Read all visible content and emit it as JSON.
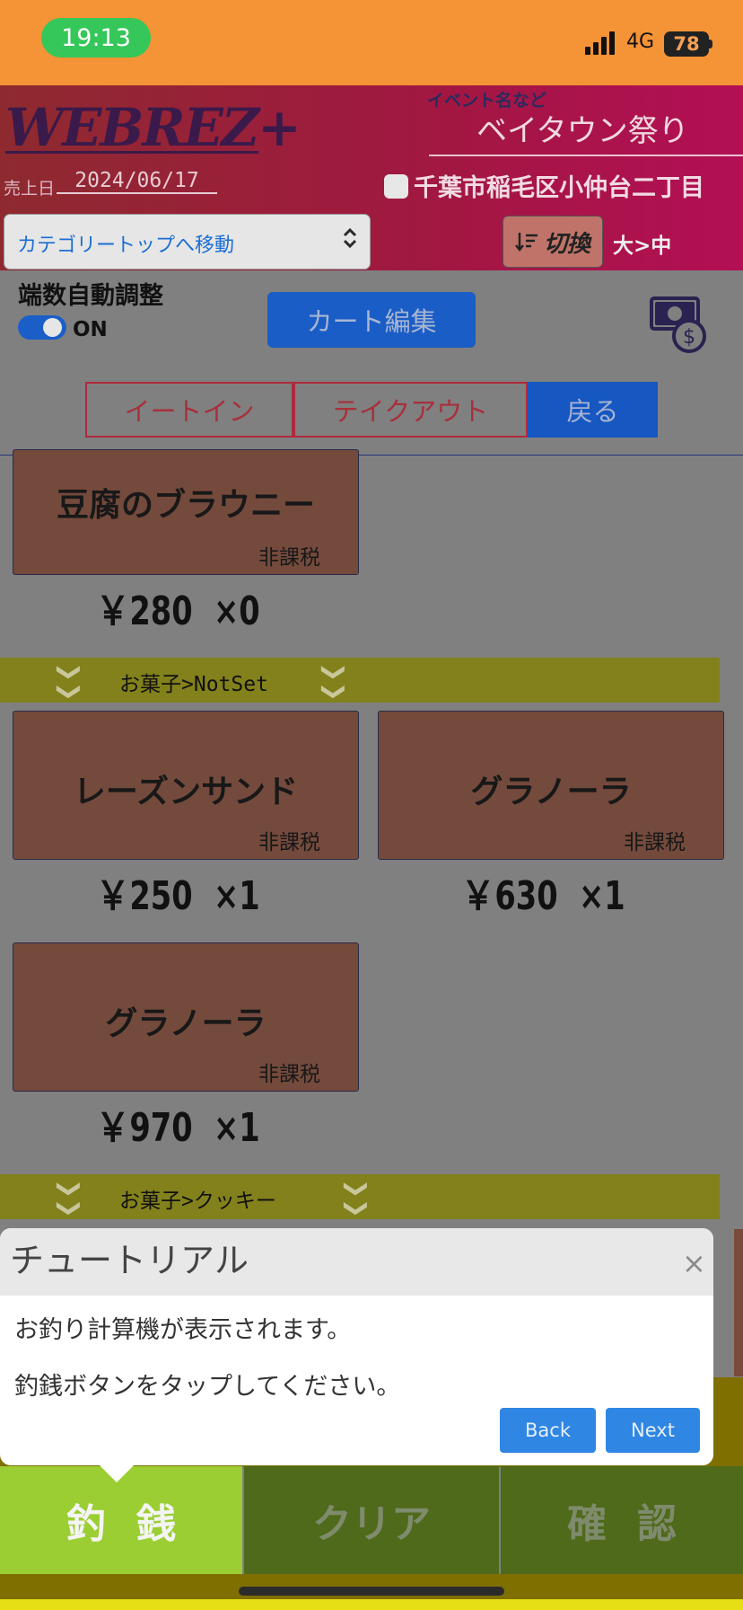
{
  "status_bar": {
    "time": "19:13",
    "network": "4G",
    "battery": "78"
  },
  "header": {
    "logo": "WEBREZ+",
    "event_label": "イベント名など",
    "event_name": "ベイタウン祭り",
    "sales_date_label": "売上日",
    "sales_date": "2024/06/17",
    "location": "千葉市稲毛区小仲台二丁目",
    "category_select": "カテゴリートップへ移動",
    "switch_button": "切換",
    "switch_mode": "大>中"
  },
  "controls": {
    "auto_adjust_label": "端数自動調整",
    "auto_adjust_state": "ON",
    "cart_edit_button": "カート編集",
    "tabs": [
      "イートイン",
      "テイクアウト",
      "戻る"
    ]
  },
  "products": [
    {
      "name": "豆腐のブラウニー",
      "tax": "非課税",
      "price": "￥280",
      "qty": "×0"
    },
    {
      "name": "レーズンサンド",
      "tax": "非課税",
      "price": "￥250",
      "qty": "×1"
    },
    {
      "name": "グラノーラ",
      "tax": "非課税",
      "price": "￥630",
      "qty": "×1"
    },
    {
      "name": "グラノーラ",
      "tax": "非課税",
      "price": "￥970",
      "qty": "×1"
    }
  ],
  "categories": [
    "お菓子>NotSet",
    "お菓子>クッキー"
  ],
  "tutorial": {
    "title": "チュートリアル",
    "line1": "お釣り計算機が表示されます。",
    "line2": "釣銭ボタンをタップしてください。",
    "back": "Back",
    "next": "Next"
  },
  "bottom_bar": {
    "change": "釣銭",
    "clear": "クリア",
    "confirm": "確認"
  },
  "icons": {
    "close": "×",
    "chevron": "❯❯",
    "select": "chevron-updown-icon",
    "money": "money-icon",
    "sort": "sort-icon"
  },
  "colors": {
    "status_bar": "#f59337",
    "accent_blue": "#1a5dc6",
    "change_button": "#9bce32",
    "card": "#744a3c",
    "category_bar": "#82811c"
  }
}
